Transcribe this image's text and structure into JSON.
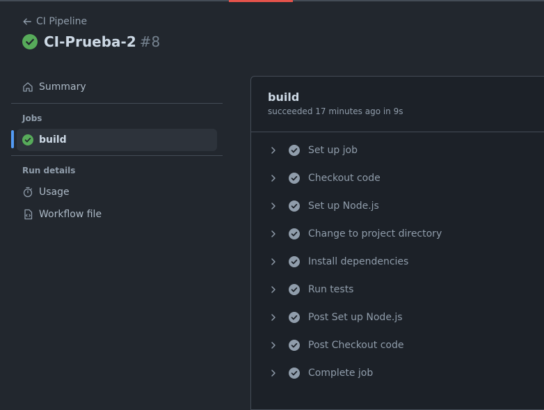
{
  "header": {
    "back_label": "CI Pipeline",
    "run_name": "CI-Prueba-2",
    "run_number": "#8"
  },
  "sidebar": {
    "summary_label": "Summary",
    "jobs_title": "Jobs",
    "jobs": [
      {
        "label": "build"
      }
    ],
    "run_details_title": "Run details",
    "run_details": [
      {
        "label": "Usage",
        "icon": "stopwatch-icon"
      },
      {
        "label": "Workflow file",
        "icon": "file-code-icon"
      }
    ]
  },
  "job": {
    "title": "build",
    "status_text": "succeeded 17 minutes ago in 9s",
    "steps": [
      {
        "label": "Set up job"
      },
      {
        "label": "Checkout code"
      },
      {
        "label": "Set up Node.js"
      },
      {
        "label": "Change to project directory"
      },
      {
        "label": "Install dependencies"
      },
      {
        "label": "Run tests"
      },
      {
        "label": "Post Set up Node.js"
      },
      {
        "label": "Post Checkout code"
      },
      {
        "label": "Complete job"
      }
    ]
  },
  "colors": {
    "background": "#22272e",
    "panel": "#1c2128",
    "success": "#57ab5a",
    "accent": "#539bf5",
    "top_accent": "#e5534b"
  }
}
